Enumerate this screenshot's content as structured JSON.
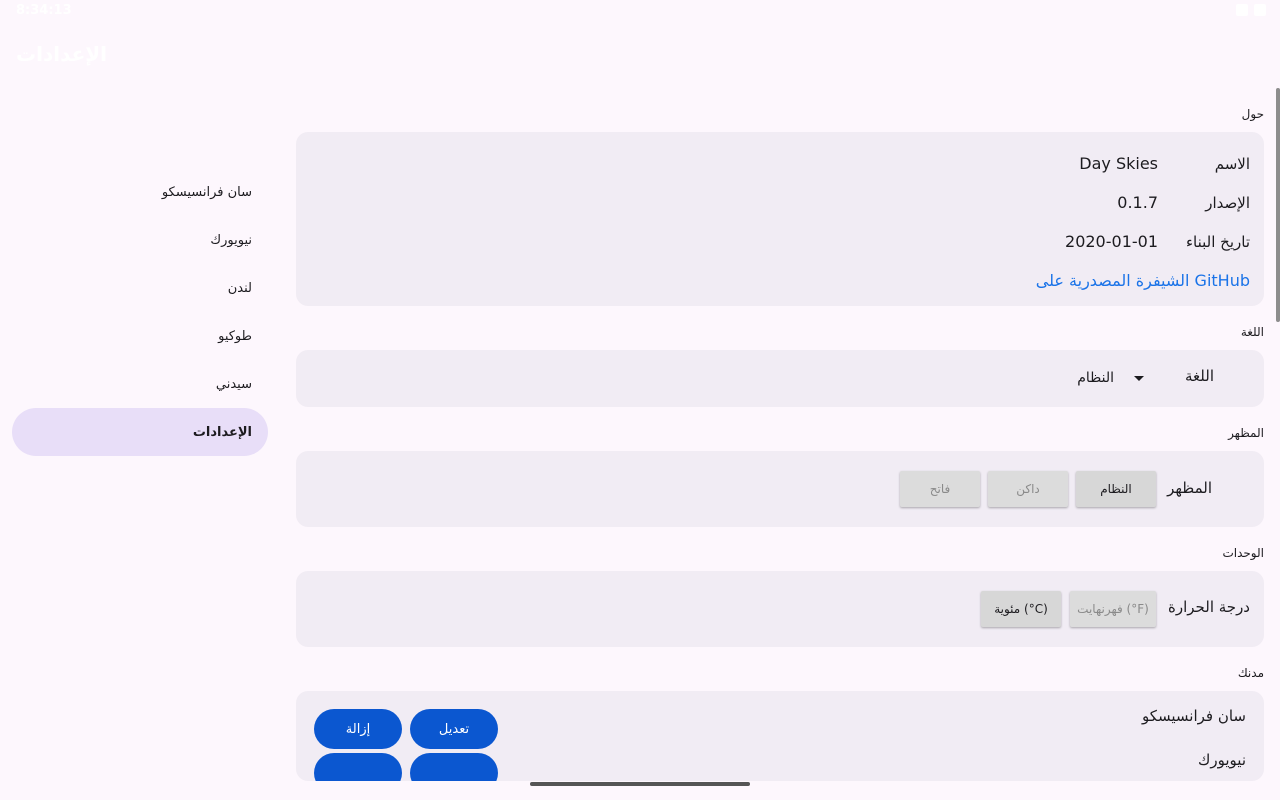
{
  "status_bar": {
    "time": "8:34:13"
  },
  "app_title": "الإعدادات",
  "sidebar": {
    "items": [
      {
        "label": "سان فرانسيسكو"
      },
      {
        "label": "نيويورك"
      },
      {
        "label": "لندن"
      },
      {
        "label": "طوكيو"
      },
      {
        "label": "سيدني"
      },
      {
        "label": "الإعدادات",
        "active": true
      }
    ]
  },
  "about": {
    "section_label": "حول",
    "name_key": "الاسم",
    "name_val": "Day Skies",
    "version_key": "الإصدار",
    "version_val": "0.1.7",
    "build_key": "تاريخ البناء",
    "build_val": "2020-01-01",
    "source_link": "الشيفرة المصدرية على GitHub"
  },
  "language": {
    "section_label": "اللغة",
    "key": "اللغة",
    "selected": "النظام"
  },
  "theme": {
    "section_label": "المظهر",
    "key": "المظهر",
    "options": [
      "النظام",
      "داكن",
      "فاتح"
    ],
    "selected": "النظام"
  },
  "units": {
    "section_label": "الوحدات",
    "key": "درجة الحرارة",
    "options": [
      "فهرنهايت (°F)",
      "مئوية (°C)"
    ],
    "selected": "مئوية (°C)"
  },
  "cities": {
    "section_label": "مدنك",
    "items": [
      {
        "name": "سان فرانسيسكو",
        "edit": "تعديل",
        "remove": "إزالة"
      },
      {
        "name": "نيويورك"
      }
    ]
  },
  "colors": {
    "accent": "#0b57d0",
    "link": "#1a73e8",
    "selected_nav": "#e8def8",
    "card": "#f1ecf4"
  }
}
